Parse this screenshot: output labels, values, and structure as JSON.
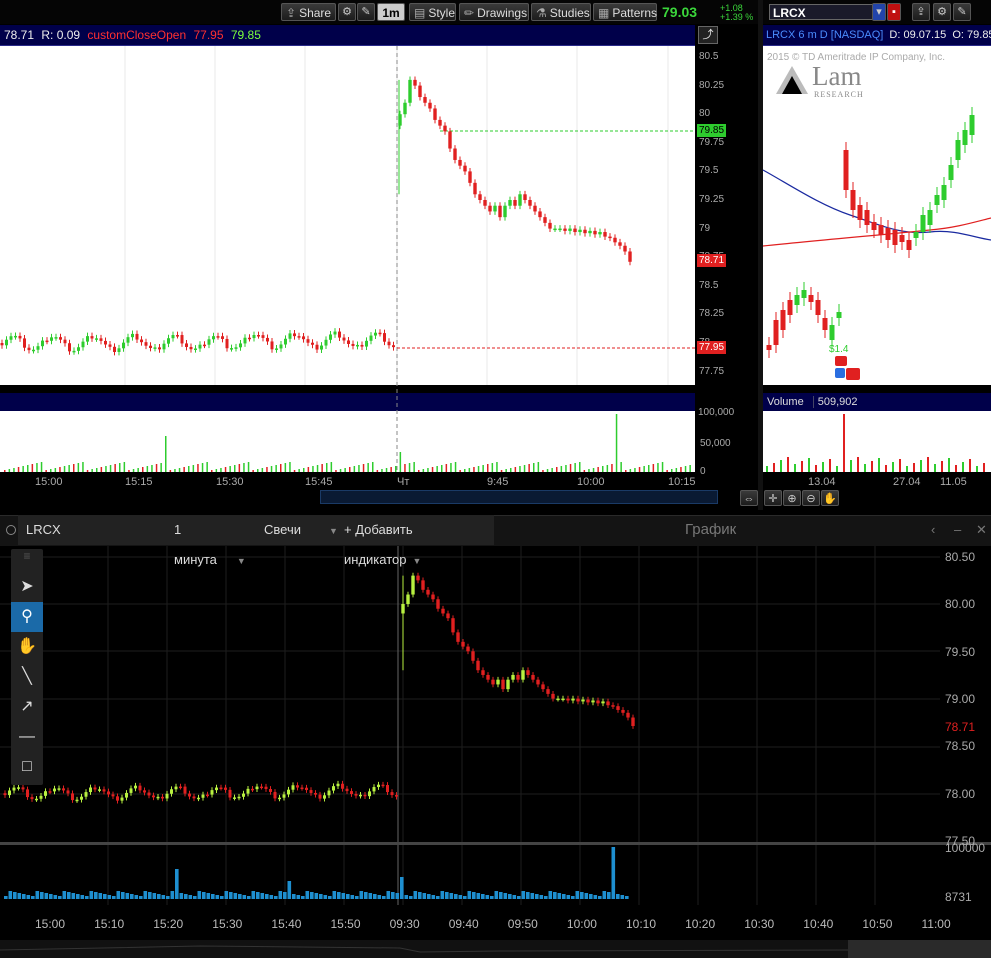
{
  "toolbar": {
    "share_label": "Share",
    "interval_label": "1m",
    "style_label": "Style",
    "drawings_label": "Drawings",
    "studies_label": "Studies",
    "patterns_label": "Patterns",
    "last_price": "79.03",
    "change_abs": "+1.08",
    "change_pct": "+1.39 %"
  },
  "intraday": {
    "header": {
      "last": "78.71",
      "r": "R: 0.09",
      "study": "customCloseOpen",
      "v1": "77.95",
      "v2": "79.85"
    },
    "y_labels": [
      "80.5",
      "80.25",
      "80",
      "79.75",
      "79.5",
      "79.25",
      "79",
      "78.75",
      "78.5",
      "78.25",
      "78",
      "77.75"
    ],
    "price_tags": {
      "upper": "79.85",
      "last": "78.71",
      "lower": "77.95"
    },
    "volume_labels": [
      "100,000",
      "50,000",
      "0"
    ],
    "x_labels": [
      "15:00",
      "15:15",
      "15:30",
      "15:45",
      "Чт",
      "9:45",
      "10:00",
      "10:15"
    ]
  },
  "daily": {
    "symbol": "LRCX",
    "header": {
      "title": "LRCX 6 m D [NASDAQ]",
      "date": "D: 09.07.15",
      "open": "O: 79.85"
    },
    "copyright": "2015 © TD Ameritrade IP Company, Inc.",
    "logo_text": "Lam",
    "logo_sub": "RESEARCH",
    "dividend_label": "$1.4",
    "volume_label": "Volume",
    "volume_value": "509,902",
    "x_labels": [
      "13.04",
      "27.04",
      "11.05"
    ]
  },
  "lower": {
    "symbol": "LRCX",
    "interval": "1 минута",
    "chart_type": "Свечи",
    "add_indicator": "+ Добавить индикатор",
    "panel_title": "График",
    "y_labels": [
      "80.50",
      "80.00",
      "79.50",
      "79.00",
      "78.50",
      "78.00",
      "77.50"
    ],
    "last_price": "78.71",
    "volume_max": "100000",
    "volume_last": "8731",
    "x_labels": [
      "15:00",
      "15:10",
      "15:20",
      "15:30",
      "15:40",
      "15:50",
      "09:30",
      "09:40",
      "09:50",
      "10:00",
      "10:10",
      "10:20",
      "10:30",
      "10:40",
      "10:50",
      "11:00"
    ]
  },
  "colors": {
    "up": "#2ecc2e",
    "down": "#e02020",
    "header_bg": "#00004a",
    "accent": "#1b6aa8",
    "lower_up": "#b8f040",
    "lower_vol": "#1e8fd0"
  }
}
